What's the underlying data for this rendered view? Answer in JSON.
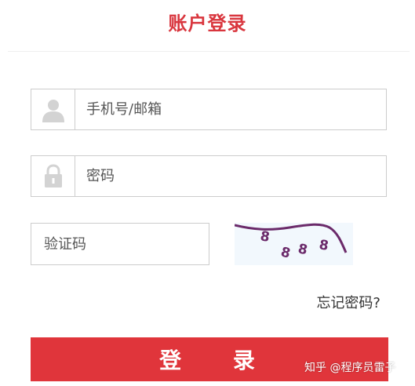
{
  "header": {
    "title": "账户登录"
  },
  "form": {
    "phone_placeholder": "手机号/邮箱",
    "password_placeholder": "密码",
    "captcha_placeholder": "验证码",
    "captcha_text": "8 8 8 8",
    "forgot_label": "忘记密码?",
    "login_label": "登 录"
  },
  "watermark": {
    "text": "知乎 @程序员雷子"
  },
  "icons": {
    "user": "user-icon",
    "lock": "lock-icon"
  },
  "colors": {
    "accent": "#e0353b",
    "title": "#d9363e",
    "border": "#cccccc",
    "icon": "#d3d3d3",
    "captcha_glyph": "#6b2a6a"
  }
}
